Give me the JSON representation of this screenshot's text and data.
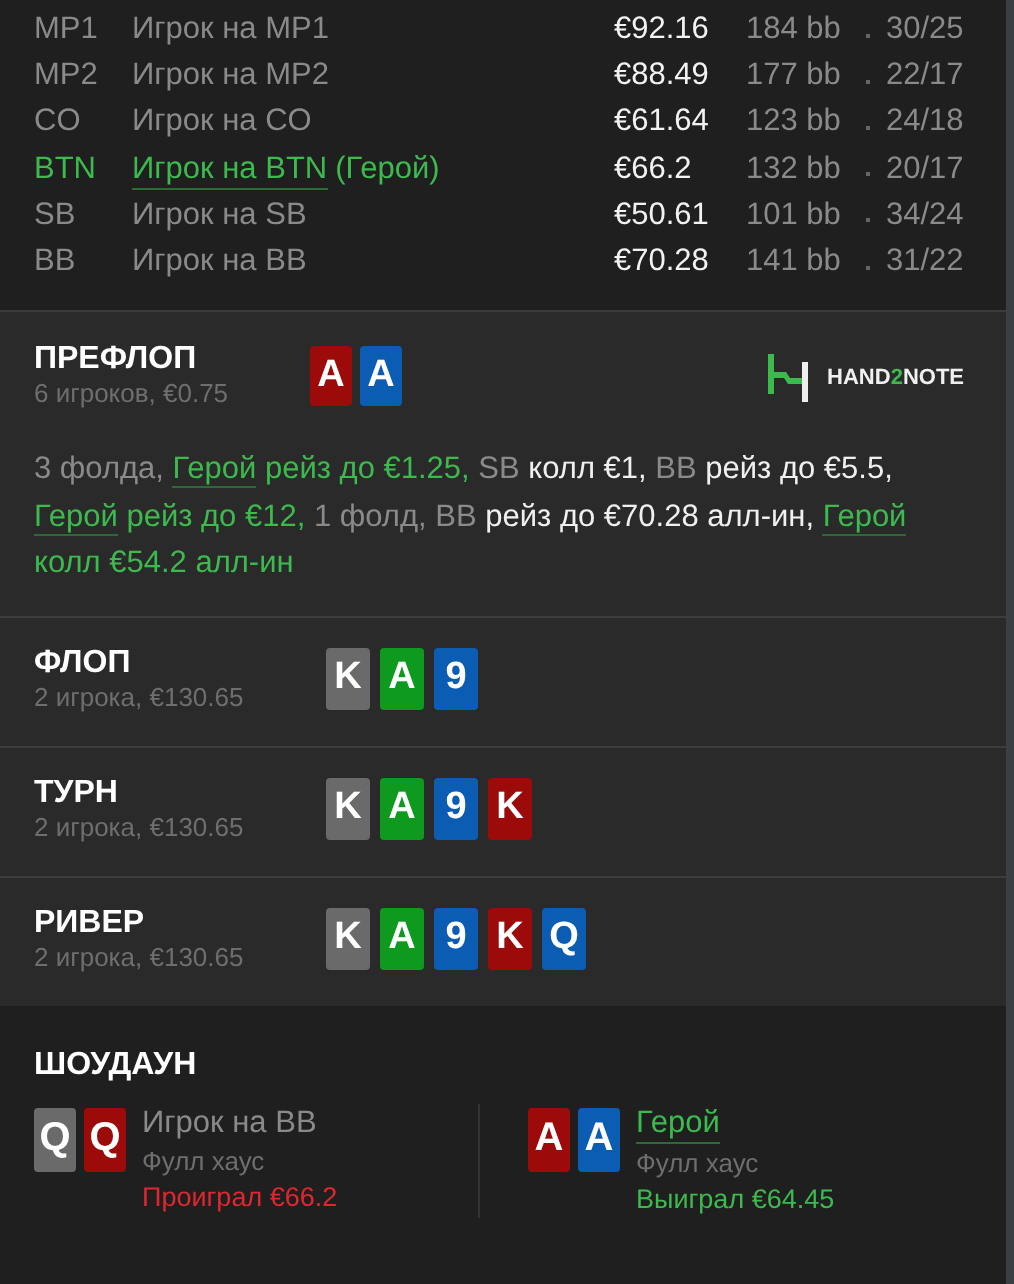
{
  "players": [
    {
      "position": "MP1",
      "name": "Игрок на MP1",
      "hero": false,
      "stack": "€92.16",
      "bb": "184 bb",
      "stats": "30/25"
    },
    {
      "position": "MP2",
      "name": "Игрок на MP2",
      "hero": false,
      "stack": "€88.49",
      "bb": "177 bb",
      "stats": "22/17"
    },
    {
      "position": "CO",
      "name": "Игрок на CO",
      "hero": false,
      "stack": "€61.64",
      "bb": "123 bb",
      "stats": "24/18"
    },
    {
      "position": "BTN",
      "name": "Игрок на BTN",
      "suffix": "(Герой)",
      "hero": true,
      "stack": "€66.2",
      "bb": "132 bb",
      "stats": "20/17"
    },
    {
      "position": "SB",
      "name": "Игрок на SB",
      "hero": false,
      "stack": "€50.61",
      "bb": "101 bb",
      "stats": "34/24"
    },
    {
      "position": "BB",
      "name": "Игрок на BB",
      "hero": false,
      "stack": "€70.28",
      "bb": "141 bb",
      "stats": "31/22"
    }
  ],
  "preflop": {
    "title": "ПРЕФЛОП",
    "subtitle": "6 игроков, €0.75",
    "cards": [
      {
        "rank": "A",
        "color": "#9c0a0a"
      },
      {
        "rank": "A",
        "color": "#0b5db3"
      }
    ],
    "logo": [
      "HAND",
      "2",
      "NOTE"
    ],
    "actions": [
      {
        "kind": "fold",
        "text": "3 фолда, "
      },
      {
        "kind": "hero-link",
        "text": "Герой"
      },
      {
        "kind": "hero",
        "text": " рейз до €1.25, "
      },
      {
        "kind": "pos",
        "text": "SB"
      },
      {
        "kind": "action",
        "text": " колл €1, "
      },
      {
        "kind": "pos",
        "text": "BB"
      },
      {
        "kind": "action",
        "text": " рейз до €5.5, "
      },
      {
        "kind": "hero-link",
        "text": "Герой"
      },
      {
        "kind": "hero",
        "text": " рейз до €12, "
      },
      {
        "kind": "fold",
        "text": "1 фолд, "
      },
      {
        "kind": "pos",
        "text": "BB"
      },
      {
        "kind": "action",
        "text": " рейз до €70.28 алл-ин, "
      },
      {
        "kind": "hero-link",
        "text": "Герой"
      },
      {
        "kind": "hero",
        "text": " колл €54.2 алл-ин"
      }
    ]
  },
  "streets": [
    {
      "title": "ФЛОП",
      "subtitle": "2 игрока, €130.65",
      "cards": [
        {
          "rank": "K",
          "color": "#6a6a6a"
        },
        {
          "rank": "A",
          "color": "#0d9a1f"
        },
        {
          "rank": "9",
          "color": "#0b5db3"
        }
      ]
    },
    {
      "title": "ТУРН",
      "subtitle": "2 игрока, €130.65",
      "cards": [
        {
          "rank": "K",
          "color": "#6a6a6a"
        },
        {
          "rank": "A",
          "color": "#0d9a1f"
        },
        {
          "rank": "9",
          "color": "#0b5db3"
        },
        {
          "rank": "K",
          "color": "#9c0a0a"
        }
      ]
    },
    {
      "title": "РИВЕР",
      "subtitle": "2 игрока, €130.65",
      "cards": [
        {
          "rank": "K",
          "color": "#6a6a6a"
        },
        {
          "rank": "A",
          "color": "#0d9a1f"
        },
        {
          "rank": "9",
          "color": "#0b5db3"
        },
        {
          "rank": "K",
          "color": "#9c0a0a"
        },
        {
          "rank": "Q",
          "color": "#0b5db3"
        }
      ]
    }
  ],
  "showdown": {
    "title": "ШОУДАУН",
    "hands": [
      {
        "cards": [
          {
            "rank": "Q",
            "color": "#6a6a6a"
          },
          {
            "rank": "Q",
            "color": "#9c0a0a"
          }
        ],
        "player": "Игрок на BB",
        "hero": false,
        "combo": "Фулл хаус",
        "result": "Проиграл €66.2",
        "won": false
      },
      {
        "cards": [
          {
            "rank": "A",
            "color": "#9c0a0a"
          },
          {
            "rank": "A",
            "color": "#0b5db3"
          }
        ],
        "player": "Герой",
        "hero": true,
        "combo": "Фулл хаус",
        "result": "Выиграл €64.45",
        "won": true
      }
    ]
  }
}
